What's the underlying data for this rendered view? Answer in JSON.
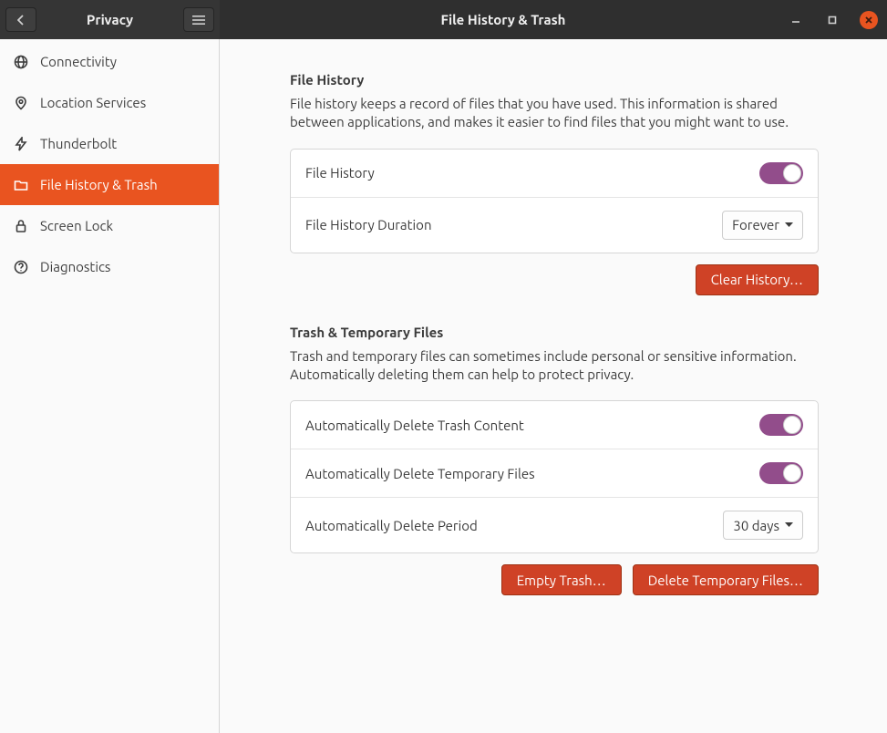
{
  "header": {
    "sidebar_title": "Privacy",
    "page_title": "File History & Trash"
  },
  "sidebar": {
    "items": [
      {
        "icon": "globe",
        "label": "Connectivity"
      },
      {
        "icon": "location",
        "label": "Location Services"
      },
      {
        "icon": "thunderbolt",
        "label": "Thunderbolt"
      },
      {
        "icon": "folder",
        "label": "File History & Trash",
        "active": true
      },
      {
        "icon": "lock",
        "label": "Screen Lock"
      },
      {
        "icon": "question",
        "label": "Diagnostics"
      }
    ]
  },
  "file_history": {
    "title": "File History",
    "description": "File history keeps a record of files that you have used. This information is shared between applications, and makes it easier to find files that you might want to use.",
    "rows": {
      "toggle_label": "File History",
      "toggle_state": true,
      "duration_label": "File History Duration",
      "duration_value": "Forever"
    },
    "clear_button": "Clear History…"
  },
  "trash": {
    "title": "Trash & Temporary Files",
    "description": "Trash and temporary files can sometimes include personal or sensitive information. Automatically deleting them can help to protect privacy.",
    "rows": {
      "auto_trash_label": "Automatically Delete Trash Content",
      "auto_trash_state": true,
      "auto_temp_label": "Automatically Delete Temporary Files",
      "auto_temp_state": true,
      "period_label": "Automatically Delete Period",
      "period_value": "30 days"
    },
    "empty_trash_button": "Empty Trash…",
    "delete_temp_button": "Delete Temporary Files…"
  }
}
